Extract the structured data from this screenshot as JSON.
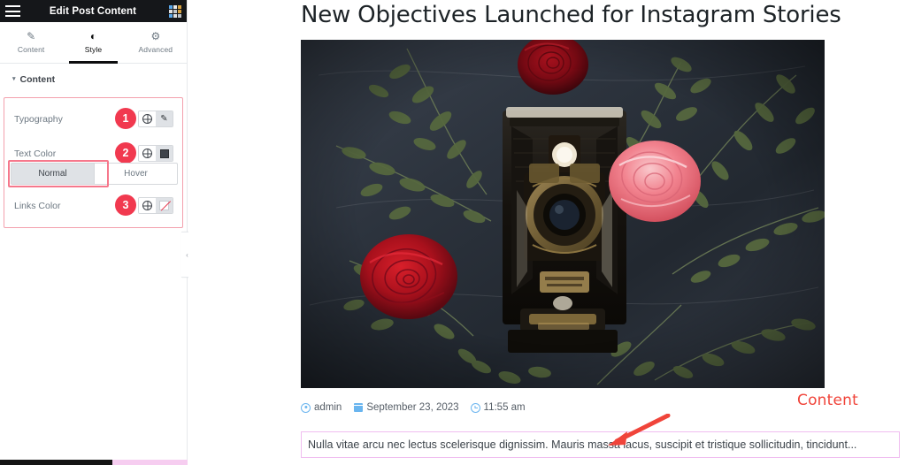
{
  "panel": {
    "title": "Edit Post Content",
    "menu_icon": "hamburger-icon",
    "apps_icon": "apps-grid-icon",
    "tabs": [
      {
        "label": "Content",
        "icon": "pencil-icon",
        "active": false
      },
      {
        "label": "Style",
        "icon": "contrast-icon",
        "active": true
      },
      {
        "label": "Advanced",
        "icon": "gear-icon",
        "active": false
      }
    ],
    "section": {
      "label": "Content",
      "caret": "▾",
      "expanded": true
    },
    "controls": [
      {
        "label": "Typography",
        "badge": "1",
        "responsive_icon": "globe-icon",
        "action_icon": "pencil-icon"
      },
      {
        "label": "Text Color",
        "badge": "2",
        "responsive_icon": "globe-icon",
        "action_icon": "color-swatch-dark"
      }
    ],
    "state_toggle": {
      "options": [
        "Normal",
        "Hover"
      ],
      "selected": "Normal"
    },
    "links_control": {
      "label": "Links Color",
      "badge": "3",
      "responsive_icon": "globe-icon",
      "action_icon": "color-swatch-none"
    },
    "collapse_handle": "‹"
  },
  "main": {
    "post_title": "New Objectives Launched for Instagram Stories",
    "featured_image_alt": "vintage-camera-with-roses-photo",
    "meta": [
      {
        "icon": "user-icon",
        "text": "admin"
      },
      {
        "icon": "calendar-icon",
        "text": "September 23, 2023"
      },
      {
        "icon": "clock-icon",
        "text": "11:55 am"
      }
    ],
    "excerpt": "Nulla vitae arcu nec lectus scelerisque dignissim. Mauris massa lacus, suscipit et tristique sollicitudin, tincidunt...",
    "annotation": {
      "label": "Content",
      "arrow": "arrow-pointing-to-excerpt"
    }
  },
  "colors": {
    "panel_header_bg": "#15171a",
    "badge_red": "#f1394f",
    "highlight_pink": "#f3a0ad",
    "excerpt_outline": "#f0bdf0",
    "annotation_red": "#f0443a",
    "meta_icon_blue": "#6ab5ef",
    "tab_active": "#0c0d0e"
  }
}
